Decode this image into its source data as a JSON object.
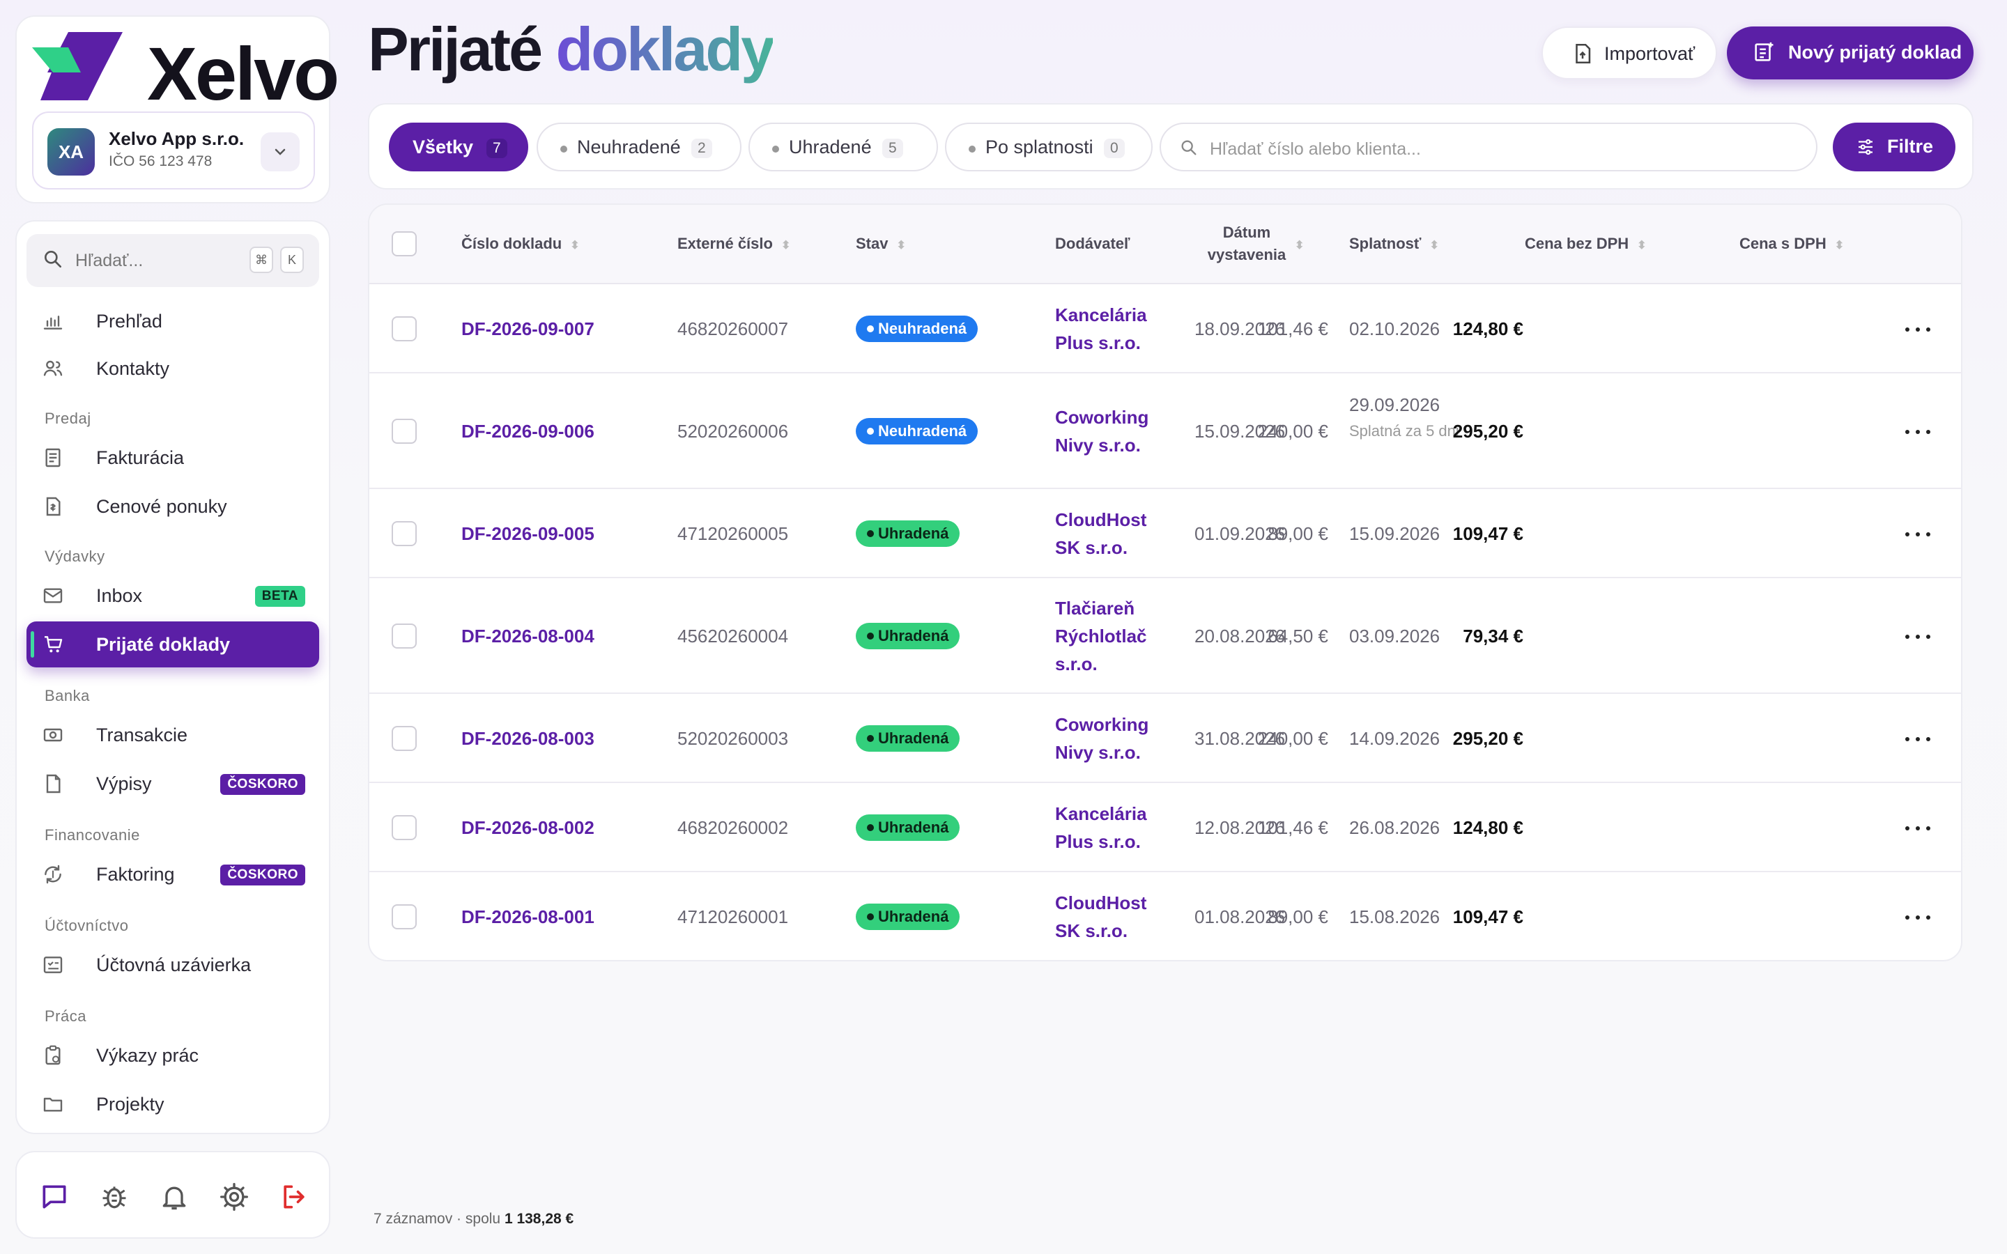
{
  "brand": {
    "name": "Xelvo",
    "logo_colors": [
      "#5b1fa6",
      "#2fd088"
    ]
  },
  "company": {
    "initials": "XA",
    "name": "Xelvo App s.r.o.",
    "ico": "IČO 56 123 478"
  },
  "sidebar": {
    "search_placeholder": "Hľadať...",
    "shortcut_keys": [
      "⌘",
      "K"
    ],
    "items": [
      {
        "label": "Prehľad",
        "icon": "chart-icon"
      },
      {
        "label": "Kontakty",
        "icon": "users-icon"
      },
      {
        "label": "Fakturácia",
        "icon": "invoice-icon"
      },
      {
        "label": "Cenové ponuky",
        "icon": "quote-icon"
      },
      {
        "label": "Inbox",
        "icon": "inbox-icon",
        "badge": "BETA"
      },
      {
        "label": "Prijaté doklady",
        "icon": "cart-icon",
        "active": true
      },
      {
        "label": "Transakcie",
        "icon": "money-icon"
      },
      {
        "label": "Výpisy",
        "icon": "statement-icon",
        "badge": "ČOSKORO"
      },
      {
        "label": "Faktoring",
        "icon": "factoring-icon",
        "badge": "ČOSKORO"
      },
      {
        "label": "Účtovná uzávierka",
        "icon": "closing-icon"
      },
      {
        "label": "Výkazy prác",
        "icon": "clipboard-icon"
      },
      {
        "label": "Projekty",
        "icon": "folder-icon"
      }
    ],
    "sections": [
      "Predaj",
      "Výdavky",
      "Banka",
      "Financovanie",
      "Účtovníctvo",
      "Práca"
    ]
  },
  "page": {
    "title_a": "Prijaté",
    "title_b": "doklady"
  },
  "actions": {
    "import": "Importovať",
    "new": "Nový prijatý doklad",
    "filter": "Filtre"
  },
  "filters": {
    "chips": [
      {
        "label": "Všetky",
        "count": "7",
        "active": true
      },
      {
        "label": "Neuhradené",
        "count": "2"
      },
      {
        "label": "Uhradené",
        "count": "5"
      },
      {
        "label": "Po splatnosti",
        "count": "0"
      }
    ],
    "search_placeholder": "Hľadať číslo alebo klienta..."
  },
  "table": {
    "headers": {
      "number": "Číslo dokladu",
      "external": "Externé číslo",
      "status": "Stav",
      "supplier": "Dodávateľ",
      "issued": "Dátum vystavenia",
      "due": "Splatnosť",
      "net": "Cena bez DPH",
      "gross": "Cena s DPH"
    },
    "rows": [
      {
        "number": "DF-2026-09-007",
        "external": "46820260007",
        "status": "Neuhradená",
        "state": "unpaid",
        "supplier": "Kancelária Plus s.r.o.",
        "issued": "18.09.2026",
        "due": "02.10.2026",
        "due_note": "",
        "net": "101,46 €",
        "gross": "124,80 €"
      },
      {
        "number": "DF-2026-09-006",
        "external": "52020260006",
        "status": "Neuhradená",
        "state": "unpaid",
        "supplier": "Coworking Nivy s.r.o.",
        "issued": "15.09.2026",
        "due": "29.09.2026",
        "due_note": "Splatná za 5 dni",
        "net": "240,00 €",
        "gross": "295,20 €"
      },
      {
        "number": "DF-2026-09-005",
        "external": "47120260005",
        "status": "Uhradená",
        "state": "paid",
        "supplier": "CloudHost SK s.r.o.",
        "issued": "01.09.2026",
        "due": "15.09.2026",
        "due_note": "",
        "net": "89,00 €",
        "gross": "109,47 €"
      },
      {
        "number": "DF-2026-08-004",
        "external": "45620260004",
        "status": "Uhradená",
        "state": "paid",
        "supplier": "Tlačiareň Rýchlotlač s.r.o.",
        "issued": "20.08.2026",
        "due": "03.09.2026",
        "due_note": "",
        "net": "64,50 €",
        "gross": "79,34 €"
      },
      {
        "number": "DF-2026-08-003",
        "external": "52020260003",
        "status": "Uhradená",
        "state": "paid",
        "supplier": "Coworking Nivy s.r.o.",
        "issued": "31.08.2026",
        "due": "14.09.2026",
        "due_note": "",
        "net": "240,00 €",
        "gross": "295,20 €"
      },
      {
        "number": "DF-2026-08-002",
        "external": "46820260002",
        "status": "Uhradená",
        "state": "paid",
        "supplier": "Kancelária Plus s.r.o.",
        "issued": "12.08.2026",
        "due": "26.08.2026",
        "due_note": "",
        "net": "101,46 €",
        "gross": "124,80 €"
      },
      {
        "number": "DF-2026-08-001",
        "external": "47120260001",
        "status": "Uhradená",
        "state": "paid",
        "supplier": "CloudHost SK s.r.o.",
        "issued": "01.08.2026",
        "due": "15.08.2026",
        "due_note": "",
        "net": "89,00 €",
        "gross": "109,47 €"
      }
    ]
  },
  "footer": {
    "summary": "7 záznamov · spolu",
    "total": "1 138,28 €"
  },
  "bottom_icons": [
    "chat-icon",
    "bug-icon",
    "bell-icon",
    "gear-icon",
    "logout-icon"
  ],
  "colors": {
    "accent": "#5b1fa6",
    "paid": "#33cf7c",
    "unpaid": "#1f7af0",
    "beta": "#2fd088"
  }
}
